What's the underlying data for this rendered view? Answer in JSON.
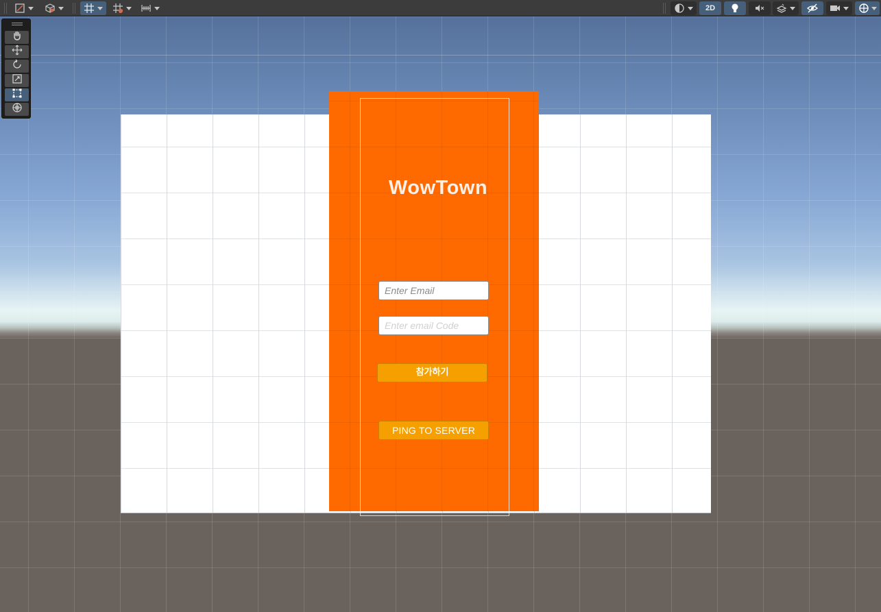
{
  "scene": {
    "app_title": "WowTown",
    "email_placeholder": "Enter Email",
    "code_placeholder": "Enter email Code",
    "join_label": "참가하기",
    "ping_label": "PING TO SERVER"
  },
  "toolbar": {
    "mode_2d_label": "2D",
    "left_tools": [
      "draw-mode-icon",
      "shading-cube-icon",
      "grid-snap-icon",
      "grid-visibility-icon",
      "increment-snap-icon"
    ],
    "right_tools": [
      "render-mode-icon",
      "2d-toggle",
      "lighting-icon",
      "audio-mute-icon",
      "effects-icon",
      "scene-visibility-icon",
      "camera-icon",
      "gizmos-icon"
    ]
  },
  "tool_palette": {
    "tools": [
      "hand-tool",
      "move-tool",
      "rotate-tool",
      "scale-tool",
      "rect-tool",
      "transform-tool"
    ],
    "active": "rect-tool"
  },
  "colors": {
    "panel": "#ff6a00",
    "button": "#f5a000",
    "toolbar": "#3c3c3c",
    "accent": "#46607c"
  }
}
